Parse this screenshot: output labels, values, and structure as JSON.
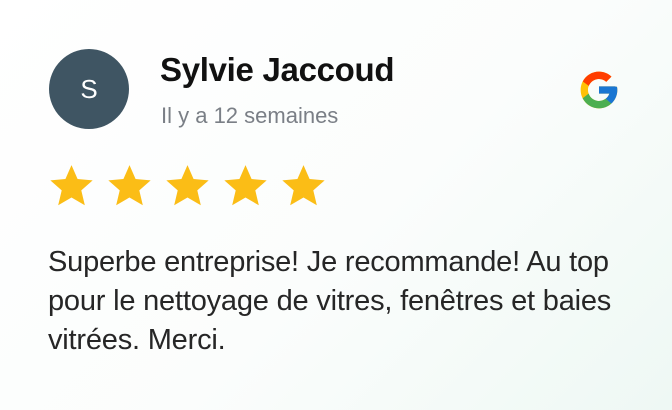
{
  "review": {
    "avatar_initial": "S",
    "author": "Sylvie Jaccoud",
    "date": "Il y a 12 semaines",
    "rating": 5,
    "rating_max": 5,
    "text": "Superbe entreprise! Je recommande! Au top pour le nettoyage de vitres, fenêtres et baies vitrées. Merci."
  },
  "icons": {
    "source": "google-logo-icon",
    "rating": "star-icon"
  },
  "colors": {
    "avatar_bg": "#3f5563",
    "star": "#fbbd16",
    "date_text": "#7a7f86",
    "google_blue": "#4285F4",
    "google_red": "#EA4335",
    "google_yellow": "#FBBC05",
    "google_green": "#34A853"
  }
}
